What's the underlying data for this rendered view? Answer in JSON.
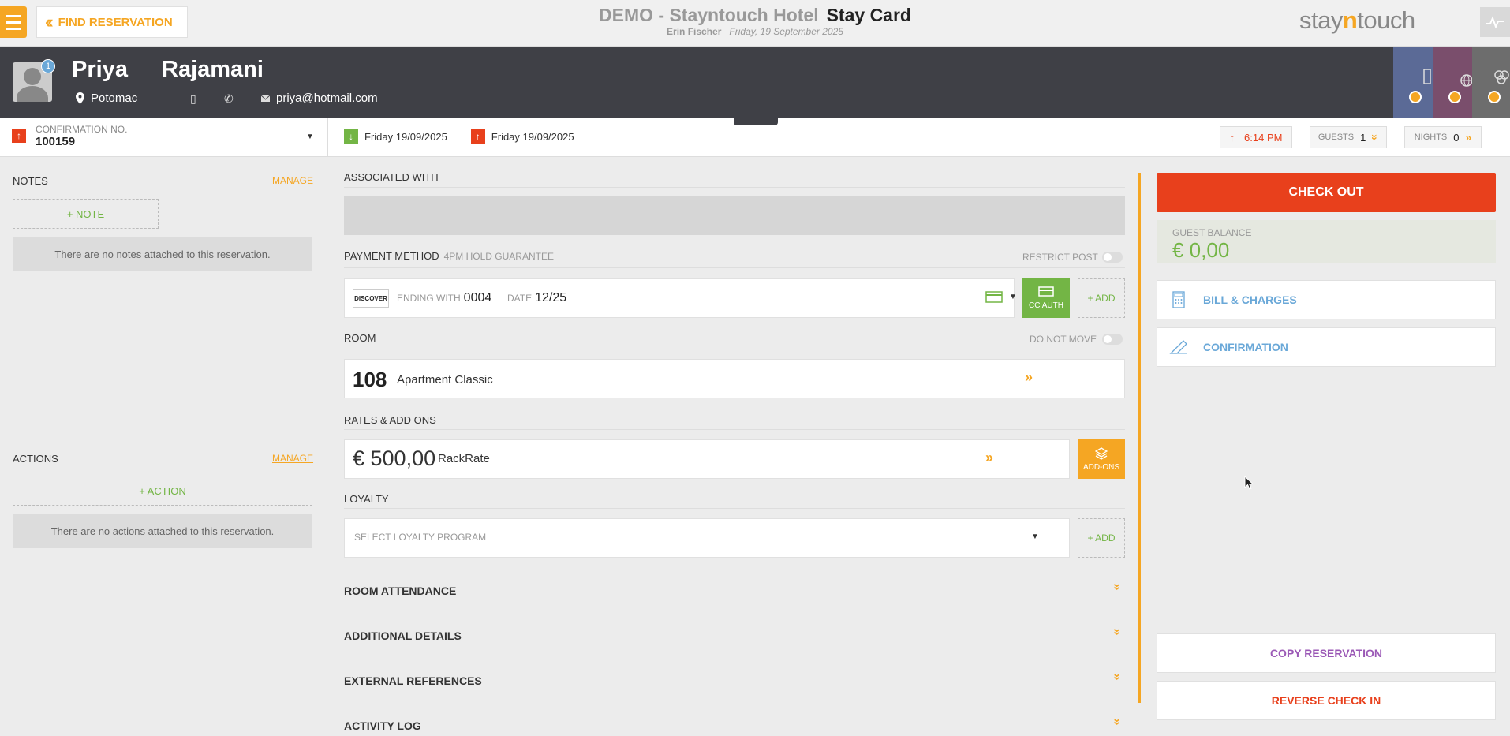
{
  "topbar": {
    "find_label": "FIND RESERVATION",
    "hotel_name": "DEMO - Stayntouch Hotel",
    "page_name": "Stay Card",
    "user": "Erin Fischer",
    "date": "Friday, 19 September 2025",
    "brand_pre": "stay",
    "brand_n": "n",
    "brand_post": "touch"
  },
  "guest": {
    "first_name": "Priya",
    "last_name": "Rajamani",
    "badge_count": "1",
    "location": "Potomac",
    "email": "priya@hotmail.com"
  },
  "reservation": {
    "confirmation_label": "CONFIRMATION NO.",
    "confirmation_no": "100159",
    "arrival": "Friday 19/09/2025",
    "departure": "Friday 19/09/2025",
    "time": "6:14 PM",
    "guests_label": "GUESTS",
    "guests": "1",
    "nights_label": "NIGHTS",
    "nights": "0"
  },
  "left": {
    "notes_label": "NOTES",
    "manage_label": "MANAGE",
    "add_note": "+ NOTE",
    "no_notes": "There are no notes attached to this reservation.",
    "actions_label": "ACTIONS",
    "add_action": "+ ACTION",
    "no_actions": "There are no actions attached to this reservation."
  },
  "center": {
    "associated_label": "ASSOCIATED WITH",
    "payment_label": "PAYMENT METHOD",
    "payment_sub": "4PM HOLD GUARANTEE",
    "restrict_post": "RESTRICT POST",
    "card_brand": "DISCOVER",
    "ending_label": "ENDING WITH",
    "ending_value": "0004",
    "date_label": "DATE",
    "date_value": "12/25",
    "cc_auth": "CC AUTH",
    "add_label": "+ ADD",
    "room_label": "ROOM",
    "do_not_move": "DO NOT MOVE",
    "room_number": "108",
    "room_type": "Apartment Classic",
    "rates_label": "RATES & ADD ONS",
    "rate_value": "€ 500,00",
    "rate_name": "RackRate",
    "addons_label": "ADD-ONS",
    "loyalty_label": "LOYALTY",
    "loyalty_placeholder": "SELECT LOYALTY PROGRAM",
    "sections": [
      "ROOM ATTENDANCE",
      "ADDITIONAL DETAILS",
      "EXTERNAL REFERENCES",
      "ACTIVITY LOG"
    ]
  },
  "right": {
    "checkout": "CHECK OUT",
    "balance_label": "GUEST BALANCE",
    "balance_value": "€ 0,00",
    "bill_charges": "BILL & CHARGES",
    "confirmation": "CONFIRMATION",
    "copy_reservation": "COPY RESERVATION",
    "reverse_checkin": "REVERSE CHECK IN"
  },
  "colors": {
    "accent": "#f5a623",
    "danger": "#e8401c",
    "success": "#73b545",
    "link": "#6aa8d8",
    "header": "#3f4046",
    "copy": "#9b59b6"
  }
}
